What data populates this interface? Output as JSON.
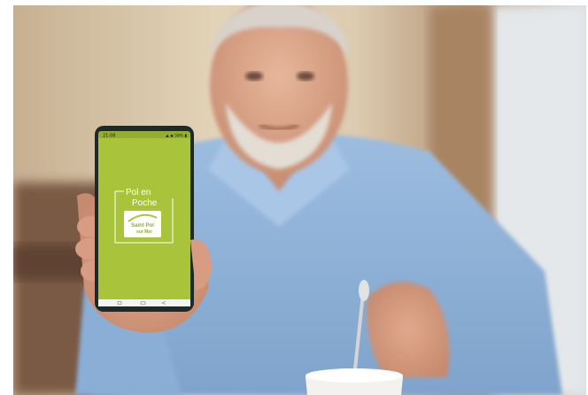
{
  "phone": {
    "status_time": "21:08",
    "status_icons": "▲ ◆ 58% ▮",
    "app_logo": {
      "line1": "Pol en",
      "line2": "Poche",
      "badge_line1": "Saint Pol",
      "badge_line2": "sur Mer"
    }
  },
  "colors": {
    "app_background": "#a9c43a",
    "shirt": "#8fb3d8",
    "wall": "#d9c7a8"
  },
  "icons": [
    "app-logo-icon"
  ]
}
